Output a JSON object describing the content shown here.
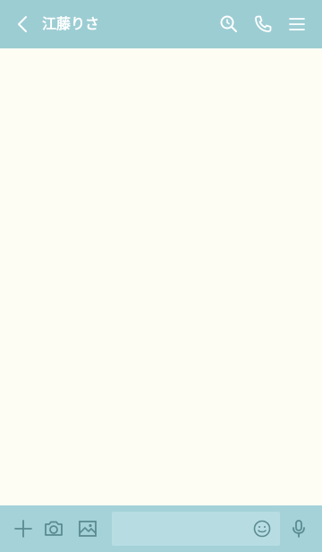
{
  "header": {
    "title": "江藤りさ",
    "back_icon": "chevron-left-icon",
    "search_icon": "search-icon",
    "call_icon": "phone-icon",
    "menu_icon": "menu-icon"
  },
  "footer": {
    "plus_icon": "plus-icon",
    "camera_icon": "camera-icon",
    "image_icon": "image-icon",
    "emoji_icon": "emoji-icon",
    "mic_icon": "microphone-icon",
    "message_input": {
      "value": "",
      "placeholder": ""
    }
  },
  "colors": {
    "header_bg": "#9ccdd3",
    "chat_bg": "#fefdf4",
    "footer_bg": "#a4d2d8",
    "input_bg": "#b7dde2",
    "icon_light": "#ffffff",
    "icon_dark": "#5a8b90"
  }
}
